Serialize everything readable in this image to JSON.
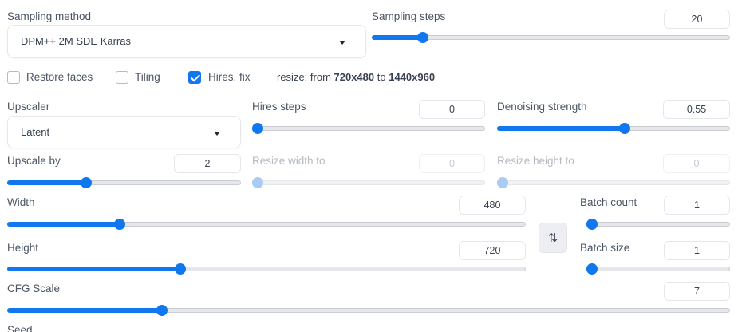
{
  "sampling_method": {
    "label": "Sampling method",
    "value": "DPM++ 2M SDE Karras"
  },
  "sampling_steps": {
    "label": "Sampling steps",
    "value": "20",
    "fraction": 0.13
  },
  "checkboxes": {
    "restore_faces": {
      "label": "Restore faces",
      "checked": false
    },
    "tiling": {
      "label": "Tiling",
      "checked": false
    },
    "hires_fix": {
      "label": "Hires. fix",
      "checked": true
    }
  },
  "resize_info": {
    "prefix": "resize: from ",
    "from": "720x480",
    "middle": " to ",
    "to": "1440x960"
  },
  "upscaler": {
    "label": "Upscaler",
    "value": "Latent"
  },
  "hires_steps": {
    "label": "Hires steps",
    "value": "0",
    "fraction": 0.0
  },
  "denoising_strength": {
    "label": "Denoising strength",
    "value": "0.55",
    "fraction": 0.55
  },
  "upscale_by": {
    "label": "Upscale by",
    "value": "2",
    "fraction": 0.33
  },
  "resize_width_to": {
    "label": "Resize width to",
    "value": "0",
    "fraction": 0.0
  },
  "resize_height_to": {
    "label": "Resize height to",
    "value": "0",
    "fraction": 0.0
  },
  "width": {
    "label": "Width",
    "value": "480",
    "fraction": 0.21
  },
  "height": {
    "label": "Height",
    "value": "720",
    "fraction": 0.33
  },
  "swap_button": {
    "glyph": "⇅"
  },
  "batch_count": {
    "label": "Batch count",
    "value": "1",
    "fraction": 0.0
  },
  "batch_size": {
    "label": "Batch size",
    "value": "1",
    "fraction": 0.0
  },
  "cfg_scale": {
    "label": "CFG Scale",
    "value": "7",
    "fraction": 0.21
  },
  "seed": {
    "label": "Seed"
  },
  "colors": {
    "accent": "#1177ee"
  }
}
